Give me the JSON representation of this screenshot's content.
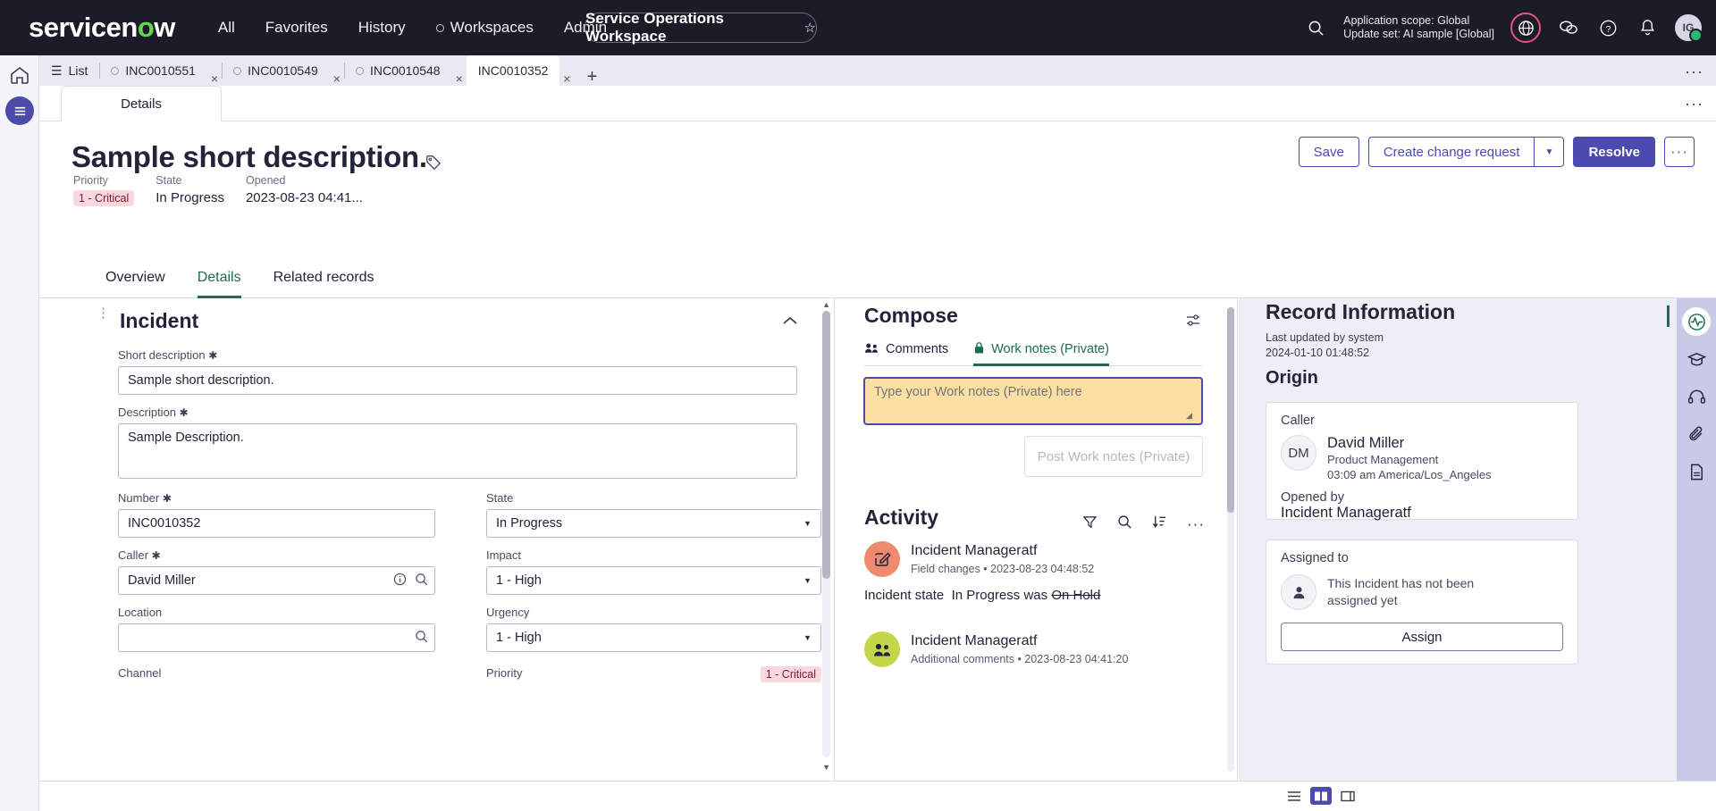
{
  "topnav": {
    "logo_text": "servicenow",
    "links": [
      "All",
      "Favorites",
      "History",
      "Workspaces",
      "Admin"
    ],
    "workspace_pill": "Service Operations Workspace",
    "scope_line1": "Application scope: Global",
    "scope_line2": "Update set: AI sample [Global]",
    "avatar_initials": "IG"
  },
  "tabstrip": {
    "list_label": "List",
    "tabs": [
      {
        "label": "INC0010551",
        "active": false
      },
      {
        "label": "INC0010549",
        "active": false
      },
      {
        "label": "INC0010548",
        "active": false
      },
      {
        "label": "INC0010352",
        "active": true
      }
    ],
    "close_label": "×",
    "add_label": "+",
    "more_label": "···"
  },
  "details_tab": {
    "label": "Details",
    "more_label": "···"
  },
  "record": {
    "title": "Sample short description.",
    "meta": [
      {
        "label": "Priority",
        "value": "1 - Critical",
        "badge": true
      },
      {
        "label": "State",
        "value": "In Progress",
        "badge": false
      },
      {
        "label": "Opened",
        "value": "2023-08-23 04:41...",
        "badge": false
      }
    ],
    "actions": {
      "save": "Save",
      "create_change_request": "Create change request",
      "resolve": "Resolve",
      "more": "···"
    }
  },
  "page_tabs": [
    {
      "label": "Overview",
      "active": false
    },
    {
      "label": "Details",
      "active": true
    },
    {
      "label": "Related records",
      "active": false
    }
  ],
  "form": {
    "section_title": "Incident",
    "fields": {
      "short_description": {
        "label": "Short description",
        "required": "✱",
        "value": "Sample short description."
      },
      "description": {
        "label": "Description",
        "required": "✱",
        "value": "Sample Description."
      },
      "number": {
        "label": "Number",
        "required": "✱",
        "value": "INC0010352"
      },
      "caller": {
        "label": "Caller",
        "required": "✱",
        "value": "David Miller"
      },
      "location": {
        "label": "Location",
        "required": "",
        "value": ""
      },
      "channel": {
        "label": "Channel",
        "required": "",
        "value": ""
      },
      "state": {
        "label": "State",
        "value": "In Progress"
      },
      "impact": {
        "label": "Impact",
        "value": "1 - High"
      },
      "urgency": {
        "label": "Urgency",
        "value": "1 - High"
      },
      "priority": {
        "label": "Priority",
        "value": "1 - Critical"
      }
    }
  },
  "compose": {
    "title": "Compose",
    "tabs": [
      {
        "label": "Comments",
        "active": false
      },
      {
        "label": "Work notes (Private)",
        "active": true
      }
    ],
    "placeholder": "Type your Work notes (Private) here",
    "value": "",
    "post_button": "Post Work notes (Private)"
  },
  "activity": {
    "title": "Activity",
    "entries": [
      {
        "author": "Incident Manageratf",
        "subtitle": "Field changes • 2023-08-23 04:48:52",
        "avatar_color": "#f08a6e",
        "avatar_icon": "edit-icon",
        "change_prefix": "Incident state",
        "change_new": "In Progress",
        "change_was_label": "was",
        "change_old": "On Hold"
      },
      {
        "author": "Incident Manageratf",
        "subtitle": "Additional comments • 2023-08-23 04:41:20",
        "avatar_color": "#c4d64a",
        "avatar_icon": "people-icon"
      }
    ]
  },
  "record_info": {
    "title": "Record Information",
    "last_updated_label": "Last updated by system",
    "last_updated_value": "2024-01-10 01:48:52",
    "origin_title": "Origin",
    "caller": {
      "label": "Caller",
      "initials": "DM",
      "name": "David Miller",
      "department": "Product Management",
      "local_time": "03:09 am America/Los_Angeles"
    },
    "opened_by": {
      "label": "Opened by",
      "value": "Incident Manageratf"
    },
    "assigned_to": {
      "label": "Assigned to",
      "empty_text": "This Incident has not been assigned yet",
      "button": "Assign"
    }
  },
  "colors": {
    "brand_purple": "#4a4ab0",
    "accent_green": "#1c6b52",
    "critical_bg": "#fbd7df",
    "critical_fg": "#7a2030",
    "compose_bg": "#fbdfa4"
  }
}
